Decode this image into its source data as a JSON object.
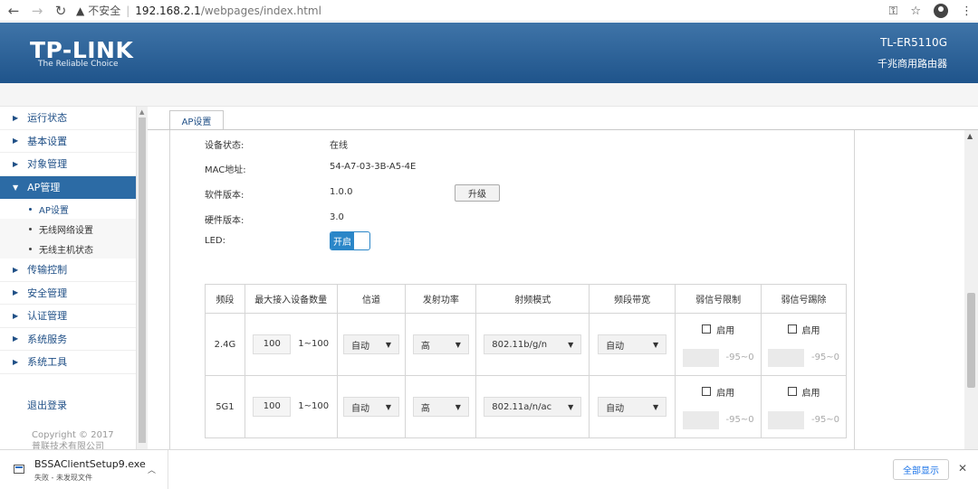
{
  "browser": {
    "security_label": "不安全",
    "url_host": "192.168.2.1",
    "url_path": "/webpages/index.html"
  },
  "header": {
    "logo": "TP-LINK",
    "tagline": "The Reliable Choice",
    "model": "TL-ER5110G",
    "model_sub": "千兆商用路由器"
  },
  "sidebar": {
    "items": [
      {
        "label": "运行状态"
      },
      {
        "label": "基本设置"
      },
      {
        "label": "对象管理"
      },
      {
        "label": "AP管理"
      },
      {
        "label": "传输控制"
      },
      {
        "label": "安全管理"
      },
      {
        "label": "认证管理"
      },
      {
        "label": "系统服务"
      },
      {
        "label": "系统工具"
      }
    ],
    "sub_items": [
      {
        "label": "AP设置"
      },
      {
        "label": "无线网络设置"
      },
      {
        "label": "无线主机状态"
      }
    ],
    "logout": "退出登录",
    "copyright_line1": "Copyright © 2017",
    "copyright_line2": "普联技术有限公司"
  },
  "tab": {
    "label": "AP设置"
  },
  "info": {
    "status_label": "设备状态:",
    "status_value": "在线",
    "mac_label": "MAC地址:",
    "mac_value": "54-A7-03-3B-A5-4E",
    "sw_label": "软件版本:",
    "sw_value": "1.0.0",
    "upgrade_button": "升级",
    "hw_label": "硬件版本:",
    "hw_value": "3.0",
    "led_label": "LED:",
    "led_toggle": "开启"
  },
  "table": {
    "headers": [
      "频段",
      "最大接入设备数量",
      "信道",
      "发射功率",
      "射频模式",
      "频段带宽",
      "弱信号限制",
      "弱信号踢除"
    ],
    "rows": [
      {
        "band": "2.4G",
        "max_clients": "100",
        "range": "1~100",
        "channel": "自动",
        "power": "高",
        "mode": "802.11b/g/n",
        "bandwidth": "自动",
        "limit_label": "启用",
        "limit_value": "-95~0",
        "kick_label": "启用",
        "kick_value": "-95~0"
      },
      {
        "band": "5G1",
        "max_clients": "100",
        "range": "1~100",
        "channel": "自动",
        "power": "高",
        "mode": "802.11a/n/ac",
        "bandwidth": "自动",
        "limit_label": "启用",
        "limit_value": "-95~0",
        "kick_label": "启用",
        "kick_value": "-95~0"
      }
    ]
  },
  "download": {
    "file_name": "BSSAClientSetup9.exe",
    "status": "失败 - 未发现文件",
    "show_all": "全部显示"
  },
  "colors": {
    "header_blue": "#2c5f96",
    "accent": "#2a86c8",
    "sidebar_active": "#2c6ba5"
  }
}
